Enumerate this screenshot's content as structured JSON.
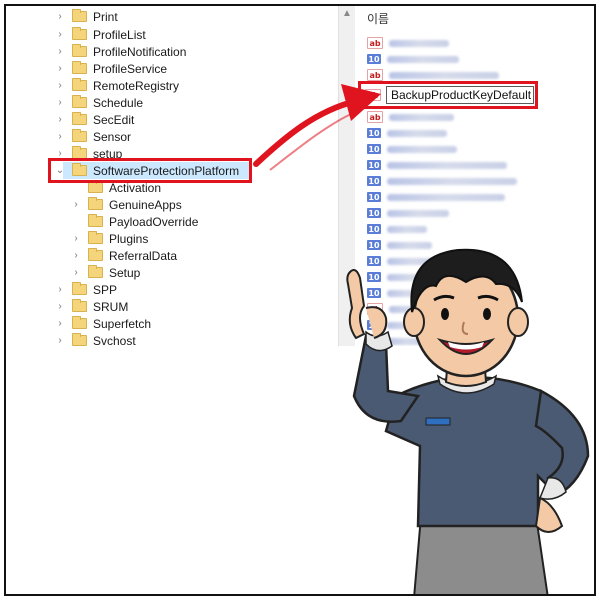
{
  "tree": {
    "items": [
      {
        "label": "Print",
        "expand": "›"
      },
      {
        "label": "ProfileList",
        "expand": "›"
      },
      {
        "label": "ProfileNotification",
        "expand": "›"
      },
      {
        "label": "ProfileService",
        "expand": "›"
      },
      {
        "label": "RemoteRegistry",
        "expand": "›"
      },
      {
        "label": "Schedule",
        "expand": "›"
      },
      {
        "label": "SecEdit",
        "expand": "›"
      },
      {
        "label": "Sensor",
        "expand": "›"
      },
      {
        "label": "setup",
        "expand": "›"
      },
      {
        "label": "SoftwareProtectionPlatform",
        "expand": "⌄"
      },
      {
        "label": "Activation",
        "expand": ""
      },
      {
        "label": "GenuineApps",
        "expand": "›"
      },
      {
        "label": "PayloadOverride",
        "expand": ""
      },
      {
        "label": "Plugins",
        "expand": "›"
      },
      {
        "label": "ReferralData",
        "expand": "›"
      },
      {
        "label": "Setup",
        "expand": "›"
      },
      {
        "label": "SPP",
        "expand": "›"
      },
      {
        "label": "SRUM",
        "expand": "›"
      },
      {
        "label": "Superfetch",
        "expand": "›"
      },
      {
        "label": "Svchost",
        "expand": "›"
      }
    ]
  },
  "values_pane": {
    "header": "이름",
    "highlighted_value": "BackupProductKeyDefault",
    "icon_string": "ab",
    "icon_binary": "10"
  },
  "colors": {
    "highlight_red": "#e0141e",
    "selection_blue": "#cce8ff",
    "folder_yellow": "#f4d57b",
    "shirt": "#4a5a73"
  }
}
